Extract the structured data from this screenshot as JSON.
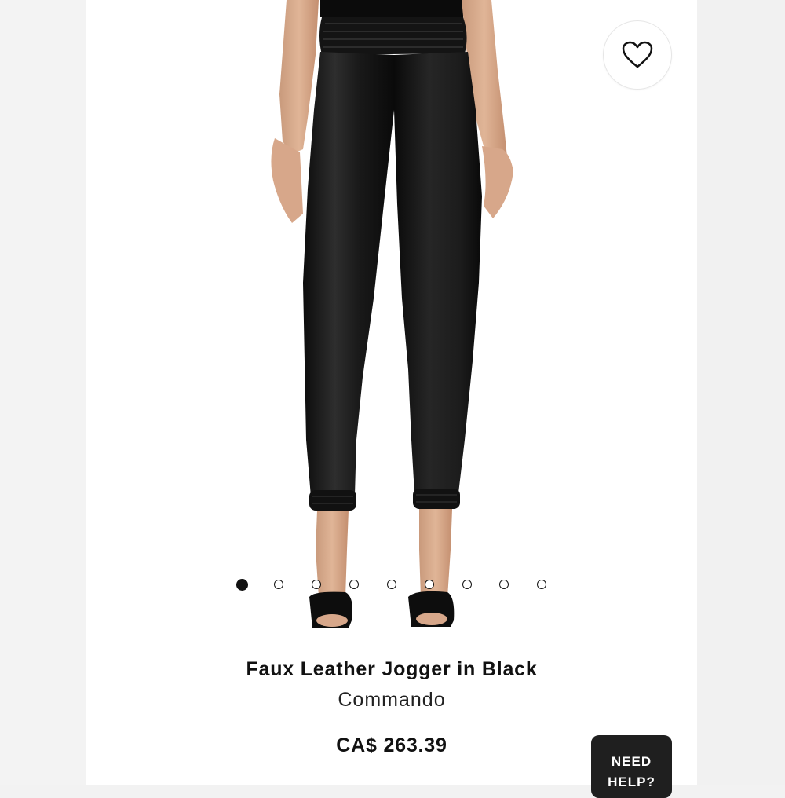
{
  "colors": {
    "page_background": "#ffffff",
    "accent_dark": "#111111",
    "help_button_bg": "#1f1f1f"
  },
  "gallery": {
    "image_icon": "product-photo-faux-leather-jogger",
    "total_images": 9,
    "active_index": 0
  },
  "wishlist": {
    "icon": "heart-outline-icon"
  },
  "product": {
    "title": "Faux Leather Jogger in Black",
    "brand": "Commando",
    "price": "CA$ 263.39"
  },
  "help": {
    "label": "NEED HELP?"
  }
}
